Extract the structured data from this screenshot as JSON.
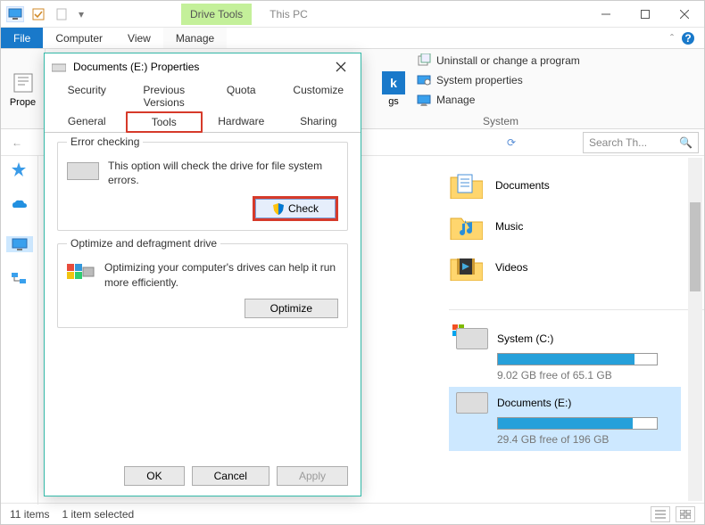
{
  "window": {
    "context_tab": "Drive Tools",
    "title": "This PC"
  },
  "ribbon_tabs": [
    "File",
    "Computer",
    "View",
    "Manage"
  ],
  "ribbon": {
    "properties_label": "Prope",
    "network_k": "k",
    "network_gs": "gs",
    "system_group": {
      "items": [
        "Uninstall or change a program",
        "System properties",
        "Manage"
      ],
      "label": "System"
    }
  },
  "search": {
    "placeholder": "Search Th..."
  },
  "folders": [
    {
      "name": "Documents"
    },
    {
      "name": "Music"
    },
    {
      "name": "Videos"
    }
  ],
  "drives": [
    {
      "name": "System (C:)",
      "free_text": "9.02 GB free of 65.1 GB",
      "fill_pct": 86,
      "os": true
    },
    {
      "name": "Documents (E:)",
      "free_text": "29.4 GB free of 196 GB",
      "fill_pct": 85,
      "os": false,
      "selected": true
    }
  ],
  "statusbar": {
    "count": "11 items",
    "selection": "1 item selected"
  },
  "dialog": {
    "title": "Documents (E:) Properties",
    "tabs_row1": [
      "Security",
      "Previous Versions",
      "Quota",
      "Customize"
    ],
    "tabs_row2": [
      "General",
      "Tools",
      "Hardware",
      "Sharing"
    ],
    "active_tab": "Tools",
    "error_checking": {
      "title": "Error checking",
      "text": "This option will check the drive for file system errors.",
      "button": "Check"
    },
    "optimize": {
      "title": "Optimize and defragment drive",
      "text": "Optimizing your computer's drives can help it run more efficiently.",
      "button": "Optimize"
    },
    "buttons": {
      "ok": "OK",
      "cancel": "Cancel",
      "apply": "Apply"
    }
  }
}
